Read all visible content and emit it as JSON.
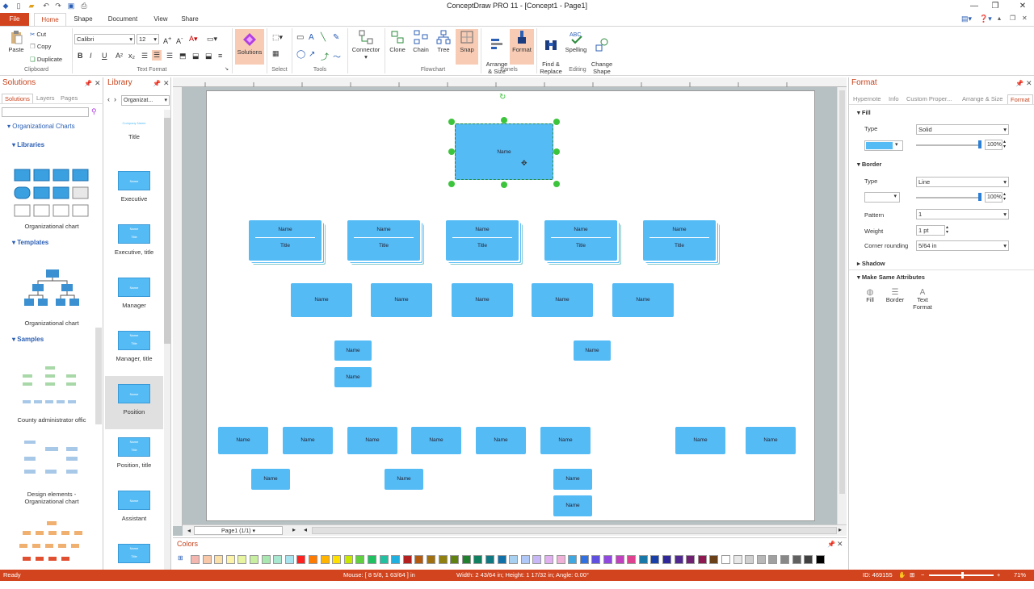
{
  "window": {
    "title": "ConceptDraw PRO 11 - [Concept1 - Page1]"
  },
  "tabs": [
    "File",
    "Home",
    "Shape",
    "Document",
    "View",
    "Share"
  ],
  "ribbon": {
    "clipboard": {
      "paste": "Paste",
      "cut": "Cut",
      "copy": "Copy",
      "duplicate": "Duplicate",
      "group": "Clipboard"
    },
    "text_format": {
      "font": "Calibri",
      "size": "12",
      "group": "Text Format"
    },
    "solutions": {
      "label": "Solutions"
    },
    "select_group": "Select",
    "tools_group": "Tools",
    "connector": "Connector",
    "flowchart": {
      "clone": "Clone",
      "chain": "Chain",
      "tree": "Tree",
      "snap": "Snap",
      "group": "Flowchart"
    },
    "panels": {
      "arrange": "Arrange\n& Size",
      "format": "Format",
      "group": "Panels"
    },
    "editing": {
      "find": "Find &\nReplace",
      "spelling": "Spelling",
      "change_shape": "Change\nShape",
      "group": "Editing"
    }
  },
  "solutions_panel": {
    "title": "Solutions",
    "tabs": [
      "Solutions",
      "Layers",
      "Pages"
    ],
    "tree_root": "Organizational Charts",
    "libraries_label": "Libraries",
    "library_caption": "Organizational chart",
    "templates_label": "Templates",
    "template_caption": "Organizational chart",
    "samples_label": "Samples",
    "samples": [
      "County administrator offic",
      "Design elements -\nOrganizational chart"
    ]
  },
  "library_panel": {
    "title": "Library",
    "dropdown": "Organizat...",
    "items": [
      "Title",
      "Executive",
      "Executive, title",
      "Manager",
      "Manager, title",
      "Position",
      "Position, title",
      "Assistant"
    ],
    "icon_texts": {
      "name": "Name",
      "title": "Title",
      "company": "Company Name"
    }
  },
  "canvas": {
    "selected_label": "Name",
    "row1": [
      {
        "name": "Name",
        "title": "Title"
      },
      {
        "name": "Name",
        "title": "Title"
      },
      {
        "name": "Name",
        "title": "Title"
      },
      {
        "name": "Name",
        "title": "Title"
      },
      {
        "name": "Name",
        "title": "Title"
      }
    ],
    "node_label": "Name",
    "page_nav": "Page1 (1/1)"
  },
  "format_panel": {
    "title": "Format",
    "tabs": [
      "Hypernote",
      "Info",
      "Custom Proper...",
      "Arrange & Size",
      "Format"
    ],
    "fill": {
      "header": "Fill",
      "type_label": "Type",
      "type_value": "Solid",
      "percent": "100%",
      "color": "#55bbf5"
    },
    "border": {
      "header": "Border",
      "type_label": "Type",
      "type_value": "Line",
      "percent": "100%",
      "pattern_label": "Pattern",
      "pattern_value": "1",
      "weight_label": "Weight",
      "weight_value": "1 pt",
      "corner_label": "Corner rounding",
      "corner_value": "5/64 in"
    },
    "shadow": "Shadow",
    "make_same": {
      "header": "Make Same Attributes",
      "fill": "Fill",
      "border": "Border",
      "text_format": "Text\nFormat"
    }
  },
  "colors_panel": {
    "title": "Colors",
    "swatches": [
      "#f4b7b0",
      "#f8c8a8",
      "#fbe0a8",
      "#fdf3a8",
      "#e8f5a0",
      "#c8eea0",
      "#a8e8b0",
      "#a8e8d0",
      "#a8e4f0",
      "#ff2020",
      "#ff7a00",
      "#ffb400",
      "#ffe000",
      "#c8e600",
      "#60d040",
      "#20c060",
      "#20c0a0",
      "#20b0e0",
      "#b42020",
      "#b45a10",
      "#a07010",
      "#908010",
      "#608010",
      "#208030",
      "#108060",
      "#107880",
      "#1070a8",
      "#a8d0f0",
      "#b0c8f8",
      "#c8b8f8",
      "#e0b0f0",
      "#f0b0d8",
      "#40a8e0",
      "#3070e0",
      "#6050e0",
      "#9048e0",
      "#c040c0",
      "#e04090",
      "#1878a8",
      "#1840a8",
      "#302898",
      "#502890",
      "#702070",
      "#901850",
      "#6a4018",
      "#ffffff",
      "#e8e8e8",
      "#d0d0d0",
      "#b8b8b8",
      "#a0a0a0",
      "#888888",
      "#606060",
      "#404040",
      "#000000"
    ]
  },
  "status": {
    "ready": "Ready",
    "mouse": "Mouse: [ 8 5/8, 1 63/64 ] in",
    "size": "Width: 2 43/64 in;  Height: 1 17/32 in;  Angle: 0.00°",
    "id": "ID: 469155",
    "zoom": "71%"
  }
}
